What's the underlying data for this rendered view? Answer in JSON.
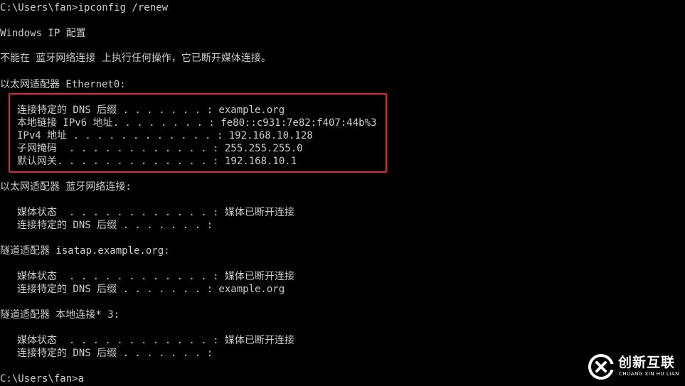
{
  "terminal": {
    "lines": [
      "C:\\Users\\fan>ipconfig /renew",
      "Windows IP 配置",
      "不能在 蓝牙网络连接 上执行任何操作，它已断开媒体连接。",
      "以太网适配器 Ethernet0:",
      "连接特定的 DNS 后缀 . . . . . . . : example.org",
      "本地链接 IPv6 地址. . . . . . . . : fe80::c931:7e82:f407:44b%3",
      "IPv4 地址 . . . . . . . . . . . . : 192.168.10.128",
      "子网掩码  . . . . . . . . . . . . : 255.255.255.0",
      "默认网关. . . . . . . . . . . . . : 192.168.10.1",
      "以太网适配器 蓝牙网络连接:",
      "媒体状态  . . . . . . . . . . . . : 媒体已断开连接",
      "连接特定的 DNS 后缀 . . . . . . . :",
      "隧道适配器 isatap.example.org:",
      "媒体状态  . . . . . . . . . . . . : 媒体已断开连接",
      "连接特定的 DNS 后缀 . . . . . . . : example.org",
      "隧道适配器 本地连接* 3:",
      "媒体状态  . . . . . . . . . . . . : 媒体已断开连接",
      "连接特定的 DNS 后缀 . . . . . . . :",
      "C:\\Users\\fan>a"
    ]
  },
  "highlight_color": "#e0262f",
  "watermark": {
    "name": "创新互联",
    "subtitle": "CHUANG XIN HU LIAN",
    "icon": "chuangxin-logo-icon"
  }
}
